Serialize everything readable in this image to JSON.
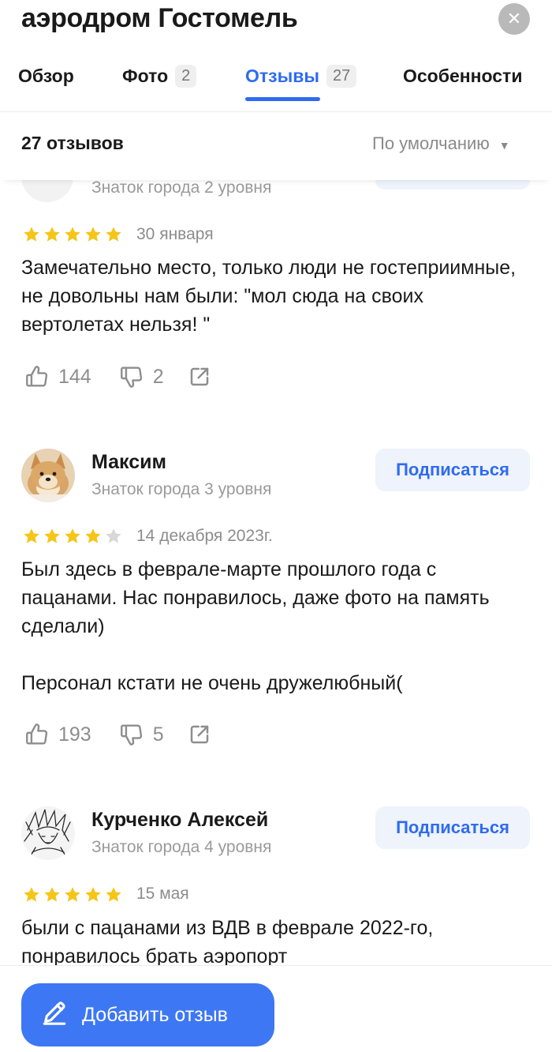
{
  "header": {
    "title": "аэродром Гостомель",
    "close_icon": "✕"
  },
  "tabs": [
    {
      "label": "Обзор",
      "count": ""
    },
    {
      "label": "Фото",
      "count": "2"
    },
    {
      "label": "Отзывы",
      "count": "27",
      "active": true
    },
    {
      "label": "Особенности",
      "count": ""
    }
  ],
  "sortbar": {
    "count_label": "27 отзывов",
    "sort_label": "По умолчанию",
    "caret": "▼"
  },
  "reviews": [
    {
      "author": "",
      "level": "Знаток города 2 уровня",
      "rating": 5,
      "date": "30 января",
      "text": "Замечательно место, только люди не гостеприимные, не довольны нам были: \"мол сюда  на своих вертолетах нельзя! \"",
      "likes": "144",
      "dislikes": "2"
    },
    {
      "author": "Максим",
      "level": "Знаток города 3 уровня",
      "subscribe_label": "Подписаться",
      "rating": 4,
      "date": "14 декабря 2023г.",
      "text": "Был здесь в феврале-марте прошлого года с пацанами. Нас понравилось, даже фото на память сделали)\n\nПерсонал кстати не очень дружелюбный(",
      "likes": "193",
      "dislikes": "5"
    },
    {
      "author": "Курченко Алексей",
      "level": "Знаток города 4 уровня",
      "subscribe_label": "Подписаться",
      "rating": 5,
      "date": "15 мая",
      "text": "были с пацанами из ВДВ в феврале 2022-го, понравилось брать аэропорт"
    }
  ],
  "footer": {
    "add_review_label": "Добавить отзыв"
  },
  "colors": {
    "accent": "#2f6bf0",
    "button": "#3d77f3",
    "star_filled": "#f5c518",
    "star_empty": "#d8d8d8"
  },
  "icons": [
    "close-icon",
    "thumb-up-icon",
    "thumb-down-icon",
    "share-icon",
    "star-icon",
    "pencil-icon"
  ]
}
